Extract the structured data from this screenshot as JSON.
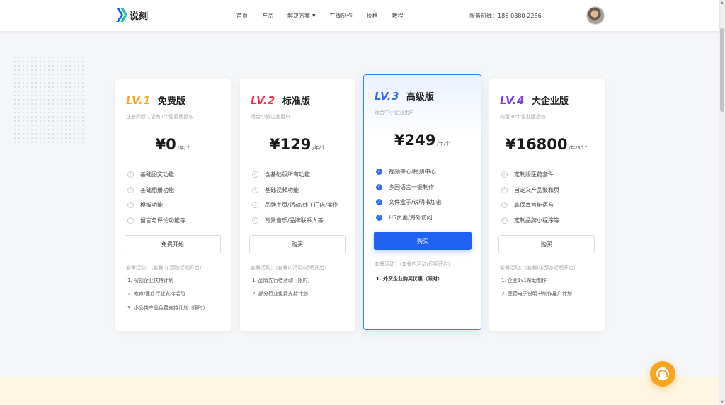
{
  "header": {
    "logo_text": "说刻",
    "nav": [
      {
        "label": "首页"
      },
      {
        "label": "产品"
      },
      {
        "label": "解决方案",
        "dropdown": true
      },
      {
        "label": "在线制作"
      },
      {
        "label": "价格"
      },
      {
        "label": "教程"
      }
    ],
    "hotline": "服务热线：186-0880-2286"
  },
  "colors": {
    "lv1": "#f5a623",
    "lv2": "#e8344e",
    "lv3": "#2f6cf6",
    "lv4": "#7b3fe4",
    "primary": "#1f62f2"
  },
  "plans": [
    {
      "level": "LV.1",
      "name": "免费版",
      "desc": "注册即默认含有1个免费版授权",
      "price": "¥0",
      "unit": "/年/个",
      "features": [
        "基础图文功能",
        "基础相册功能",
        "模板功能",
        "留言与评论功能等"
      ],
      "button": "免费开始",
      "promo_title": "套餐活动：（套餐内活动/近期开启）",
      "promos": [
        "1. 初创企业扶持计划",
        "2. 教育/医疗行业支持活动",
        "3. 小品类产品免费支持计划（限时）"
      ]
    },
    {
      "level": "LV.2",
      "name": "标准版",
      "desc": "适合小微企业用户",
      "price": "¥129",
      "unit": "/年/个",
      "features": [
        "含基础版所有功能",
        "基础视频功能",
        "品牌主页/活动/线下门店/案例",
        "背景音乐/品牌联系人等"
      ],
      "button": "购买",
      "promo_title": "套餐活动：（套餐内活动/近期开启）",
      "promos": [
        "1. 品牌先行者活动（限时）",
        "2. 部分行业免费支持计划"
      ]
    },
    {
      "level": "LV.3",
      "name": "高级版",
      "desc": "适合中小企业用户",
      "price": "¥249",
      "unit": "/年/个",
      "features": [
        "视频中心/相册中心",
        "多国语言一键制作",
        "文件盒子/说明书加密",
        "H5页面/海外访问"
      ],
      "button": "购买",
      "promo_title": "套餐活动：（套餐内活动/近期开启）",
      "promos": [
        "1. 外贸企业购买优惠（限时）"
      ]
    },
    {
      "level": "LV.4",
      "name": "大企业版",
      "desc": "内置30个企业版授权",
      "price": "¥16800",
      "unit": "/年/30个",
      "features": [
        "定制版医药套件",
        "自定义产品聚和页",
        "高保真智能语音",
        "定制品牌小程序等"
      ],
      "button": "购买",
      "promo_title": "套餐活动：（套餐内活动/近期开启）",
      "promos": [
        "1. 企业1v1帮助制作",
        "2. 医药电子说明书制作推广计划"
      ]
    }
  ]
}
